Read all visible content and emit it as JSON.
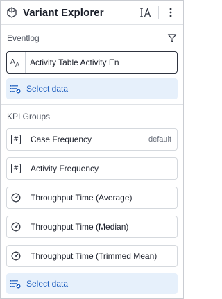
{
  "header": {
    "title": "Variant Explorer"
  },
  "eventlog": {
    "label": "Eventlog",
    "field_value": "Activity Table Activity En",
    "select_label": "Select data"
  },
  "kpi_groups": {
    "label": "KPI Groups",
    "items": [
      {
        "label": "Case Frequency",
        "badge": "default",
        "icon": "hash-icon"
      },
      {
        "label": "Activity Frequency",
        "badge": "",
        "icon": "hash-icon"
      },
      {
        "label": "Throughput Time (Average)",
        "badge": "",
        "icon": "gauge-icon"
      },
      {
        "label": "Throughput Time (Median)",
        "badge": "",
        "icon": "gauge-icon"
      },
      {
        "label": "Throughput Time (Trimmed Mean)",
        "badge": "",
        "icon": "gauge-icon"
      }
    ],
    "select_label": "Select data"
  },
  "colors": {
    "accent": "#1f5fbf",
    "select_bg": "#e6f0fb",
    "text": "#1b1f2a"
  }
}
